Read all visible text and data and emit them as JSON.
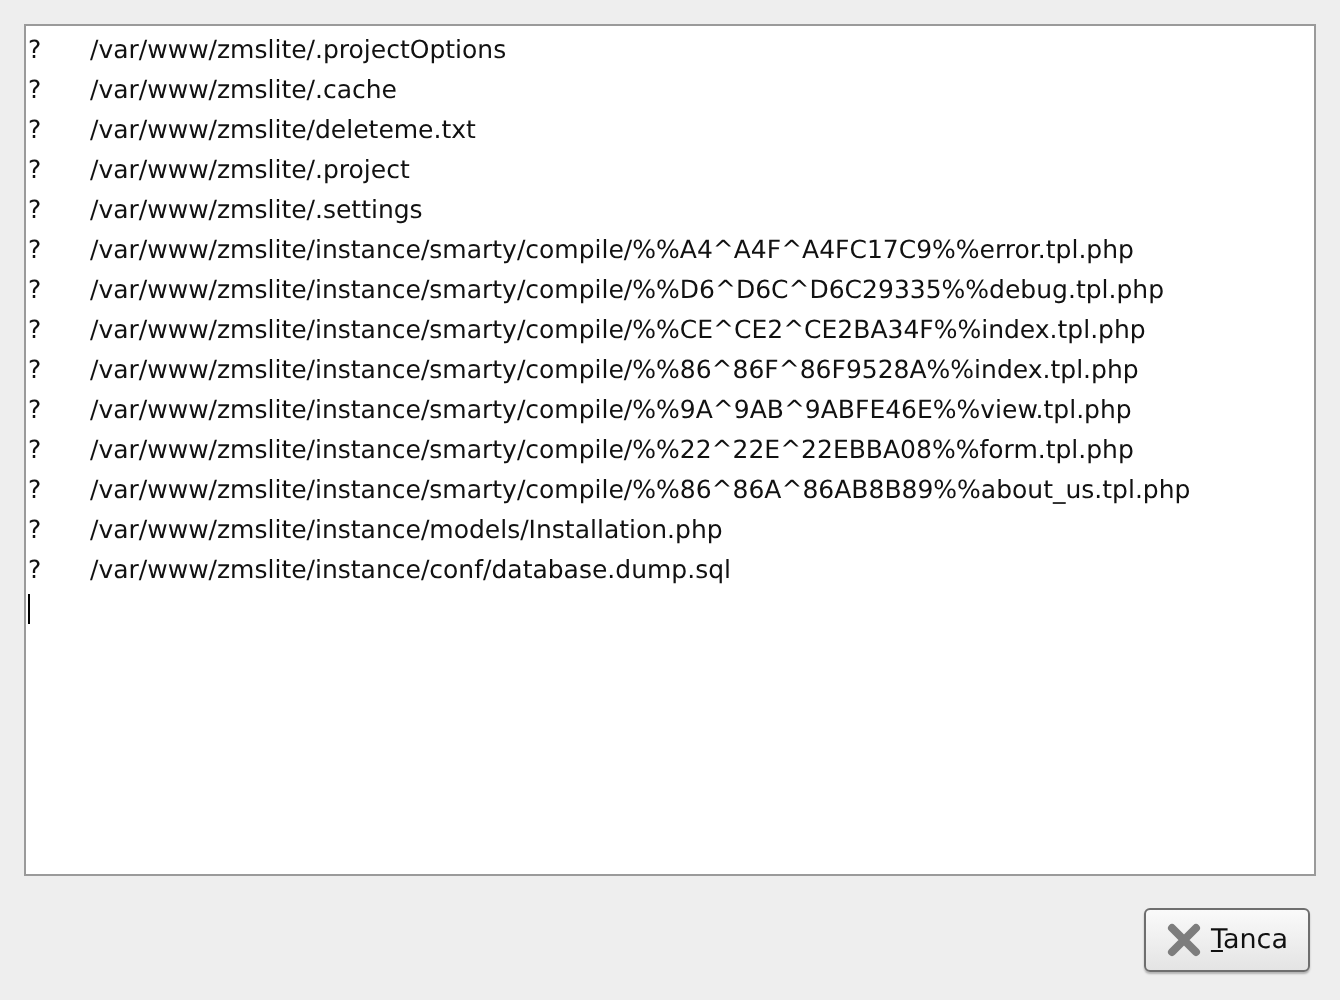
{
  "output_lines": [
    {
      "status": "?",
      "path": "/var/www/zmslite/.projectOptions"
    },
    {
      "status": "?",
      "path": "/var/www/zmslite/.cache"
    },
    {
      "status": "?",
      "path": "/var/www/zmslite/deleteme.txt"
    },
    {
      "status": "?",
      "path": "/var/www/zmslite/.project"
    },
    {
      "status": "?",
      "path": "/var/www/zmslite/.settings"
    },
    {
      "status": "?",
      "path": "/var/www/zmslite/instance/smarty/compile/%%A4^A4F^A4FC17C9%%error.tpl.php"
    },
    {
      "status": "?",
      "path": "/var/www/zmslite/instance/smarty/compile/%%D6^D6C^D6C29335%%debug.tpl.php"
    },
    {
      "status": "?",
      "path": "/var/www/zmslite/instance/smarty/compile/%%CE^CE2^CE2BA34F%%index.tpl.php"
    },
    {
      "status": "?",
      "path": "/var/www/zmslite/instance/smarty/compile/%%86^86F^86F9528A%%index.tpl.php"
    },
    {
      "status": "?",
      "path": "/var/www/zmslite/instance/smarty/compile/%%9A^9AB^9ABFE46E%%view.tpl.php"
    },
    {
      "status": "?",
      "path": "/var/www/zmslite/instance/smarty/compile/%%22^22E^22EBBA08%%form.tpl.php"
    },
    {
      "status": "?",
      "path": "/var/www/zmslite/instance/smarty/compile/%%86^86A^86AB8B89%%about_us.tpl.php"
    },
    {
      "status": "?",
      "path": "/var/www/zmslite/instance/models/Installation.php"
    },
    {
      "status": "?",
      "path": "/var/www/zmslite/instance/conf/database.dump.sql"
    }
  ],
  "close_button": {
    "label": "Tanca"
  }
}
